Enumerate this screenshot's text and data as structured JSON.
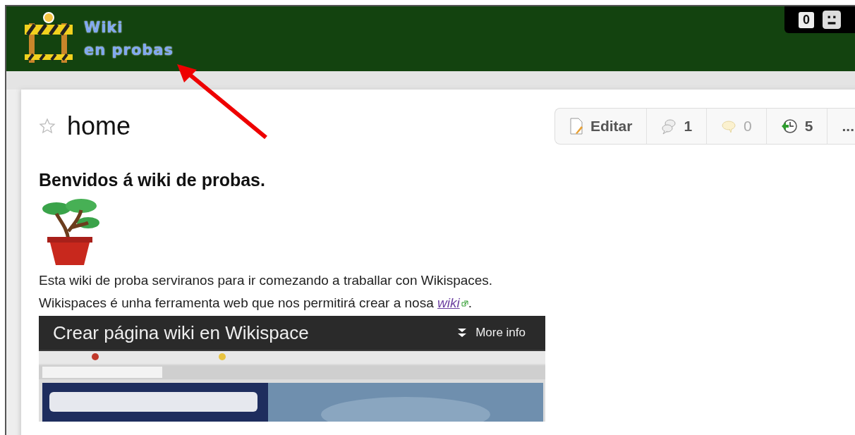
{
  "header": {
    "title_lines": [
      "Wiki",
      "en probas"
    ],
    "notification_count": "0"
  },
  "page": {
    "title": "home",
    "favorite": false,
    "toolbar": [
      {
        "kind": "edit",
        "label": "Editar",
        "disabled": false
      },
      {
        "kind": "links",
        "label": "1",
        "disabled": false
      },
      {
        "kind": "comments",
        "label": "0",
        "disabled": true
      },
      {
        "kind": "history",
        "label": "5",
        "disabled": false
      },
      {
        "kind": "more",
        "label": "...",
        "disabled": false
      }
    ]
  },
  "content": {
    "heading": "Benvidos á wiki de probas.",
    "line_1": "Esta wiki de proba serviranos para ir comezando a traballar con Wikispaces.",
    "line_2": {
      "text": "Wikispaces é unha ferramenta web que nos permitirá crear a nosa ",
      "link": "wiki",
      "after": "."
    },
    "video": {
      "title": "Crear página wiki en Wikispace",
      "more": "More info"
    }
  }
}
